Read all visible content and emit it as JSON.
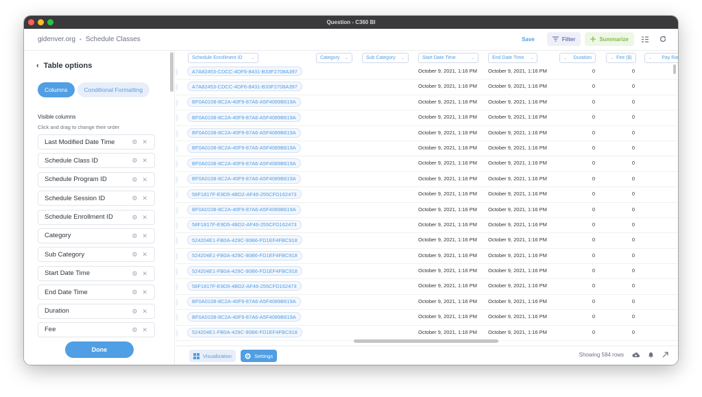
{
  "window": {
    "title": "Question - C360 BI"
  },
  "header": {
    "breadcrumb": [
      "gidenver.org",
      "Schedule Classes"
    ],
    "save_label": "Save",
    "filter_label": "Filter",
    "summarize_label": "Summarize"
  },
  "sidebar": {
    "back_label": "Table options",
    "tabs": [
      "Columns",
      "Conditional Formatting"
    ],
    "visible_title": "Visible columns",
    "hint": "Click and drag to change their order",
    "columns": [
      "Last Modified Date Time",
      "Schedule Class ID",
      "Schedule Program ID",
      "Schedule Session ID",
      "Schedule Enrollment ID",
      "Category",
      "Sub Category",
      "Start Date Time",
      "End Date Time",
      "Duration",
      "Fee"
    ],
    "done_label": "Done"
  },
  "table": {
    "headers": [
      "Schedule Enrollment ID",
      "Category",
      "Sub Category",
      "Start Date Time",
      "End Date Time",
      "Duration",
      "Fee ($)",
      "Pay Rate"
    ],
    "rows": [
      [
        "A7A82453-CDCC-4DF6-8431-B33F2708A397",
        "",
        "",
        "October 9, 2021, 1:16 PM",
        "October 9, 2021, 1:16 PM",
        "0",
        "0"
      ],
      [
        "A7A82453-CDCC-4DF6-8431-B33F2708A397",
        "",
        "",
        "October 9, 2021, 1:16 PM",
        "October 9, 2021, 1:16 PM",
        "0",
        "0"
      ],
      [
        "BF0A0108-8C2A-40F9-87A6-A5F4089B619A",
        "",
        "",
        "October 9, 2021, 1:16 PM",
        "October 9, 2021, 1:16 PM",
        "0",
        "0"
      ],
      [
        "BF0A0108-8C2A-40F9-87A6-A5F4089B619A",
        "",
        "",
        "October 9, 2021, 1:16 PM",
        "October 9, 2021, 1:16 PM",
        "0",
        "0"
      ],
      [
        "BF0A0108-8C2A-40F9-87A6-A5F4089B619A",
        "",
        "",
        "October 9, 2021, 1:16 PM",
        "October 9, 2021, 1:16 PM",
        "0",
        "0"
      ],
      [
        "BF0A0108-8C2A-40F9-87A6-A5F4089B619A",
        "",
        "",
        "October 9, 2021, 1:16 PM",
        "October 9, 2021, 1:16 PM",
        "0",
        "0"
      ],
      [
        "BF0A0108-8C2A-40F9-87A6-A5F4089B619A",
        "",
        "",
        "October 9, 2021, 1:16 PM",
        "October 9, 2021, 1:16 PM",
        "0",
        "0"
      ],
      [
        "BF0A0108-8C2A-40F9-87A6-A5F4089B619A",
        "",
        "",
        "October 9, 2021, 1:16 PM",
        "October 9, 2021, 1:16 PM",
        "0",
        "0"
      ],
      [
        "58F1817F-E9D5-4BD2-AF46-255CFD162473",
        "",
        "",
        "October 9, 2021, 1:16 PM",
        "October 9, 2021, 1:16 PM",
        "0",
        "0"
      ],
      [
        "BF0A0108-8C2A-40F9-87A6-A5F4089B619A",
        "",
        "",
        "October 9, 2021, 1:16 PM",
        "October 9, 2021, 1:16 PM",
        "0",
        "0"
      ],
      [
        "58F1817F-E9D5-4BD2-AF46-255CFD162473",
        "",
        "",
        "October 9, 2021, 1:16 PM",
        "October 9, 2021, 1:16 PM",
        "0",
        "0"
      ],
      [
        "524204E1-FB0A-429C-90B6-FD1EF4FBC918",
        "",
        "",
        "October 9, 2021, 1:16 PM",
        "October 9, 2021, 1:16 PM",
        "0",
        "0"
      ],
      [
        "524204E1-FB0A-429C-90B6-FD1EF4FBC918",
        "",
        "",
        "October 9, 2021, 1:16 PM",
        "October 9, 2021, 1:16 PM",
        "0",
        "0"
      ],
      [
        "524204E1-FB0A-429C-90B6-FD1EF4FBC918",
        "",
        "",
        "October 9, 2021, 1:16 PM",
        "October 9, 2021, 1:16 PM",
        "0",
        "0"
      ],
      [
        "58F1817F-E9D5-4BD2-AF46-255CFD162473",
        "",
        "",
        "October 9, 2021, 1:16 PM",
        "October 9, 2021, 1:16 PM",
        "0",
        "0"
      ],
      [
        "BF0A0108-8C2A-40F9-87A6-A5F4089B619A",
        "",
        "",
        "October 9, 2021, 1:16 PM",
        "October 9, 2021, 1:16 PM",
        "0",
        "0"
      ],
      [
        "BF0A0108-8C2A-40F9-87A6-A5F4089B619A",
        "",
        "",
        "October 9, 2021, 1:16 PM",
        "October 9, 2021, 1:16 PM",
        "0",
        "0"
      ],
      [
        "524204E1-FB0A-429C-90B6-FD1EF4FBC918",
        "",
        "",
        "October 9, 2021, 1:16 PM",
        "October 9, 2021, 1:16 PM",
        "0",
        "0"
      ]
    ]
  },
  "footer": {
    "visualization_label": "Visualization",
    "settings_label": "Settings",
    "row_count": "Showing 584 rows"
  },
  "icons": {
    "sort": "sort-icon",
    "refresh": "refresh-icon",
    "download": "download-icon",
    "alert": "bell-icon",
    "expand": "expand-icon"
  },
  "colors": {
    "accent": "#509ee3",
    "filter": "#7172ad",
    "summarize": "#84bb4c"
  }
}
